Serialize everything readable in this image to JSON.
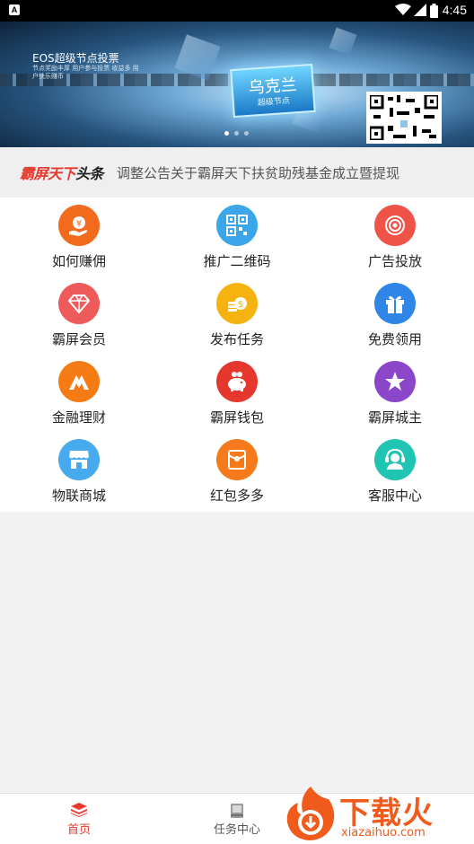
{
  "status_bar": {
    "time": "4:45",
    "app_icon_letter": "A"
  },
  "banner": {
    "heading": "EOS超级节点投票",
    "subtext": "节点奖励丰厚 用户参与投票 收益多 用户快乐赚币",
    "badge_title": "乌克兰",
    "badge_subtitle": "超级节点",
    "slide_count": 3,
    "active_slide": 1
  },
  "headline": {
    "brand_red": "霸屏天下",
    "brand_dark": "头条",
    "text": "调整公告关于霸屏天下扶贫助残基金成立暨提现"
  },
  "menu": [
    {
      "label": "如何赚佣",
      "icon": "yen-hand-icon",
      "color": "#f26b1d"
    },
    {
      "label": "推广二维码",
      "icon": "qr-code-icon",
      "color": "#3ba7ea"
    },
    {
      "label": "广告投放",
      "icon": "target-icon",
      "color": "#ef5348"
    },
    {
      "label": "霸屏会员",
      "icon": "diamond-icon",
      "color": "#ef5a5a"
    },
    {
      "label": "发布任务",
      "icon": "coin-stack-icon",
      "color": "#f6b30f"
    },
    {
      "label": "免费领用",
      "icon": "gift-icon",
      "color": "#2f86e6"
    },
    {
      "label": "金融理财",
      "icon": "mountain-icon",
      "color": "#f57c14"
    },
    {
      "label": "霸屏钱包",
      "icon": "piggy-bank-icon",
      "color": "#e6372f"
    },
    {
      "label": "霸屏城主",
      "icon": "star-icon",
      "color": "#8b46c9"
    },
    {
      "label": "物联商城",
      "icon": "store-icon",
      "color": "#47a9ee"
    },
    {
      "label": "红包多多",
      "icon": "red-envelope-icon",
      "color": "#f47a1b"
    },
    {
      "label": "客服中心",
      "icon": "headset-icon",
      "color": "#1fc5b2"
    }
  ],
  "bottom_nav": {
    "tabs": [
      {
        "label": "首页",
        "icon": "stack-icon",
        "active": true
      },
      {
        "label": "任务中心",
        "icon": "book-icon",
        "active": false
      }
    ],
    "active_color": "#e8392e",
    "inactive_color": "#555555"
  },
  "watermark": {
    "text": "下载火",
    "url": "xiazaihuo.com"
  }
}
